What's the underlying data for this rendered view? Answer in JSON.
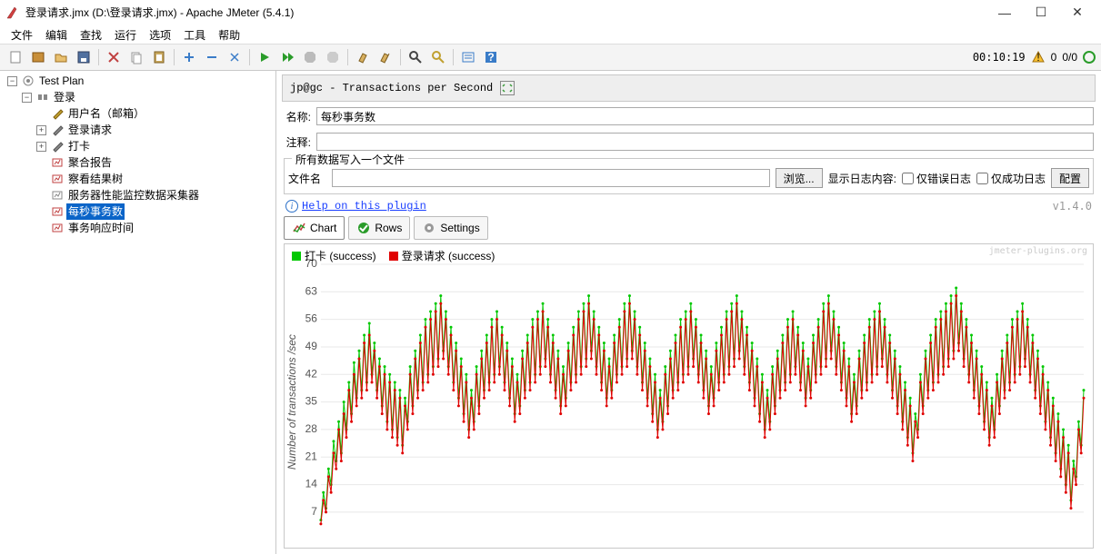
{
  "window": {
    "title": "登录请求.jmx (D:\\登录请求.jmx) - Apache JMeter (5.4.1)"
  },
  "menubar": {
    "items": [
      "文件",
      "编辑",
      "查找",
      "运行",
      "选项",
      "工具",
      "帮助"
    ]
  },
  "toolbar": {
    "timer": "00:10:19",
    "counter": "0/0",
    "errors": "0"
  },
  "tree": {
    "root": "Test Plan",
    "thread_group": "登录",
    "items": [
      "用户名（邮箱）",
      "登录请求",
      "打卡",
      "聚合报告",
      "察看结果树",
      "服务器性能监控数据采集器",
      "每秒事务数",
      "事务响应时间"
    ],
    "selected_index": 6
  },
  "panel": {
    "title": "jp@gc - Transactions per Second",
    "name_label": "名称:",
    "name_value": "每秒事务数",
    "comment_label": "注释:",
    "comment_value": "",
    "file_legend": "所有数据写入一个文件",
    "filename_label": "文件名",
    "filename_value": "",
    "browse_btn": "浏览...",
    "log_show_label": "显示日志内容:",
    "only_error_label": "仅错误日志",
    "only_success_label": "仅成功日志",
    "config_btn": "配置",
    "help_link": "Help on this plugin",
    "version": "v1.4.0"
  },
  "graph_tabs": {
    "chart": "Chart",
    "rows": "Rows",
    "settings": "Settings"
  },
  "chart_data": {
    "type": "line",
    "title": "",
    "xlabel": "",
    "ylabel": "Number of transactions /sec",
    "ylim": [
      0,
      70
    ],
    "yticks": [
      7,
      14,
      21,
      28,
      35,
      42,
      49,
      56,
      63,
      70
    ],
    "x_count": 300,
    "series": [
      {
        "name": "打卡 (success)",
        "color": "#00c800",
        "values": [
          5,
          12,
          8,
          18,
          14,
          25,
          20,
          30,
          22,
          35,
          28,
          40,
          32,
          45,
          36,
          48,
          38,
          52,
          40,
          55,
          42,
          50,
          38,
          46,
          34,
          44,
          30,
          42,
          28,
          40,
          26,
          38,
          24,
          36,
          30,
          44,
          34,
          48,
          38,
          52,
          40,
          56,
          42,
          58,
          44,
          60,
          46,
          62,
          48,
          58,
          44,
          54,
          40,
          50,
          36,
          46,
          32,
          42,
          28,
          38,
          30,
          44,
          34,
          48,
          38,
          52,
          40,
          56,
          42,
          58,
          44,
          54,
          40,
          50,
          36,
          46,
          32,
          42,
          34,
          48,
          38,
          52,
          40,
          56,
          42,
          58,
          44,
          60,
          46,
          56,
          42,
          52,
          38,
          48,
          34,
          44,
          36,
          50,
          40,
          54,
          42,
          58,
          44,
          60,
          46,
          62,
          48,
          58,
          44,
          54,
          40,
          50,
          36,
          46,
          38,
          52,
          42,
          56,
          44,
          60,
          46,
          62,
          48,
          58,
          44,
          54,
          40,
          50,
          36,
          46,
          32,
          42,
          28,
          38,
          30,
          44,
          34,
          48,
          38,
          52,
          40,
          56,
          42,
          58,
          44,
          60,
          46,
          56,
          42,
          52,
          38,
          48,
          34,
          44,
          36,
          50,
          40,
          54,
          42,
          58,
          44,
          60,
          46,
          62,
          48,
          58,
          44,
          54,
          40,
          50,
          36,
          46,
          32,
          42,
          28,
          38,
          30,
          44,
          34,
          48,
          38,
          52,
          40,
          56,
          42,
          58,
          44,
          54,
          40,
          50,
          36,
          46,
          38,
          52,
          42,
          56,
          44,
          60,
          46,
          62,
          48,
          58,
          44,
          54,
          40,
          50,
          36,
          46,
          32,
          42,
          34,
          48,
          38,
          52,
          40,
          56,
          42,
          58,
          44,
          60,
          46,
          56,
          42,
          52,
          38,
          48,
          34,
          44,
          30,
          40,
          26,
          36,
          22,
          32,
          28,
          42,
          34,
          48,
          38,
          52,
          40,
          56,
          42,
          58,
          44,
          60,
          46,
          62,
          48,
          64,
          50,
          60,
          46,
          56,
          42,
          52,
          38,
          48,
          34,
          44,
          30,
          40,
          26,
          36,
          28,
          42,
          34,
          48,
          38,
          52,
          40,
          56,
          42,
          58,
          44,
          60,
          46,
          56,
          42,
          52,
          38,
          48,
          34,
          44,
          30,
          40,
          26,
          36,
          22,
          32,
          18,
          28,
          14,
          24,
          10,
          20,
          16,
          30,
          24,
          38
        ]
      },
      {
        "name": "登录请求 (success)",
        "color": "#e00000",
        "values": [
          4,
          10,
          7,
          16,
          12,
          22,
          18,
          28,
          20,
          32,
          26,
          38,
          30,
          42,
          34,
          46,
          36,
          50,
          38,
          52,
          40,
          48,
          36,
          44,
          32,
          42,
          28,
          40,
          26,
          38,
          24,
          36,
          22,
          34,
          28,
          42,
          32,
          46,
          36,
          50,
          38,
          54,
          40,
          56,
          42,
          58,
          44,
          60,
          46,
          56,
          42,
          52,
          38,
          48,
          34,
          44,
          30,
          40,
          26,
          36,
          28,
          42,
          32,
          46,
          36,
          50,
          38,
          54,
          40,
          56,
          42,
          52,
          38,
          48,
          34,
          44,
          30,
          40,
          32,
          46,
          36,
          50,
          38,
          54,
          40,
          56,
          42,
          58,
          44,
          54,
          40,
          50,
          36,
          46,
          32,
          42,
          34,
          48,
          38,
          52,
          40,
          56,
          42,
          58,
          44,
          60,
          46,
          56,
          42,
          52,
          38,
          48,
          34,
          44,
          36,
          50,
          40,
          54,
          42,
          58,
          44,
          60,
          46,
          56,
          42,
          52,
          38,
          48,
          34,
          44,
          30,
          40,
          26,
          36,
          28,
          42,
          32,
          46,
          36,
          50,
          38,
          54,
          40,
          56,
          42,
          58,
          44,
          54,
          40,
          50,
          36,
          46,
          32,
          42,
          34,
          48,
          38,
          52,
          40,
          56,
          42,
          58,
          44,
          60,
          46,
          56,
          42,
          52,
          38,
          48,
          34,
          44,
          30,
          40,
          26,
          36,
          28,
          42,
          32,
          46,
          36,
          50,
          38,
          54,
          40,
          56,
          42,
          52,
          38,
          48,
          34,
          44,
          36,
          50,
          40,
          54,
          42,
          58,
          44,
          60,
          46,
          56,
          42,
          52,
          38,
          48,
          34,
          44,
          30,
          40,
          32,
          46,
          36,
          50,
          38,
          54,
          40,
          56,
          42,
          58,
          44,
          54,
          40,
          50,
          36,
          46,
          32,
          42,
          28,
          38,
          24,
          34,
          20,
          30,
          26,
          40,
          32,
          46,
          36,
          50,
          38,
          54,
          40,
          56,
          42,
          58,
          44,
          60,
          46,
          62,
          48,
          58,
          44,
          54,
          40,
          50,
          36,
          46,
          32,
          42,
          28,
          38,
          24,
          34,
          26,
          40,
          32,
          46,
          36,
          50,
          38,
          54,
          40,
          56,
          42,
          58,
          44,
          54,
          40,
          50,
          36,
          46,
          32,
          42,
          28,
          38,
          24,
          34,
          20,
          30,
          16,
          26,
          12,
          22,
          8,
          18,
          14,
          28,
          22,
          36
        ]
      }
    ]
  },
  "chart_legend_brand": "jmeter-plugins.org"
}
